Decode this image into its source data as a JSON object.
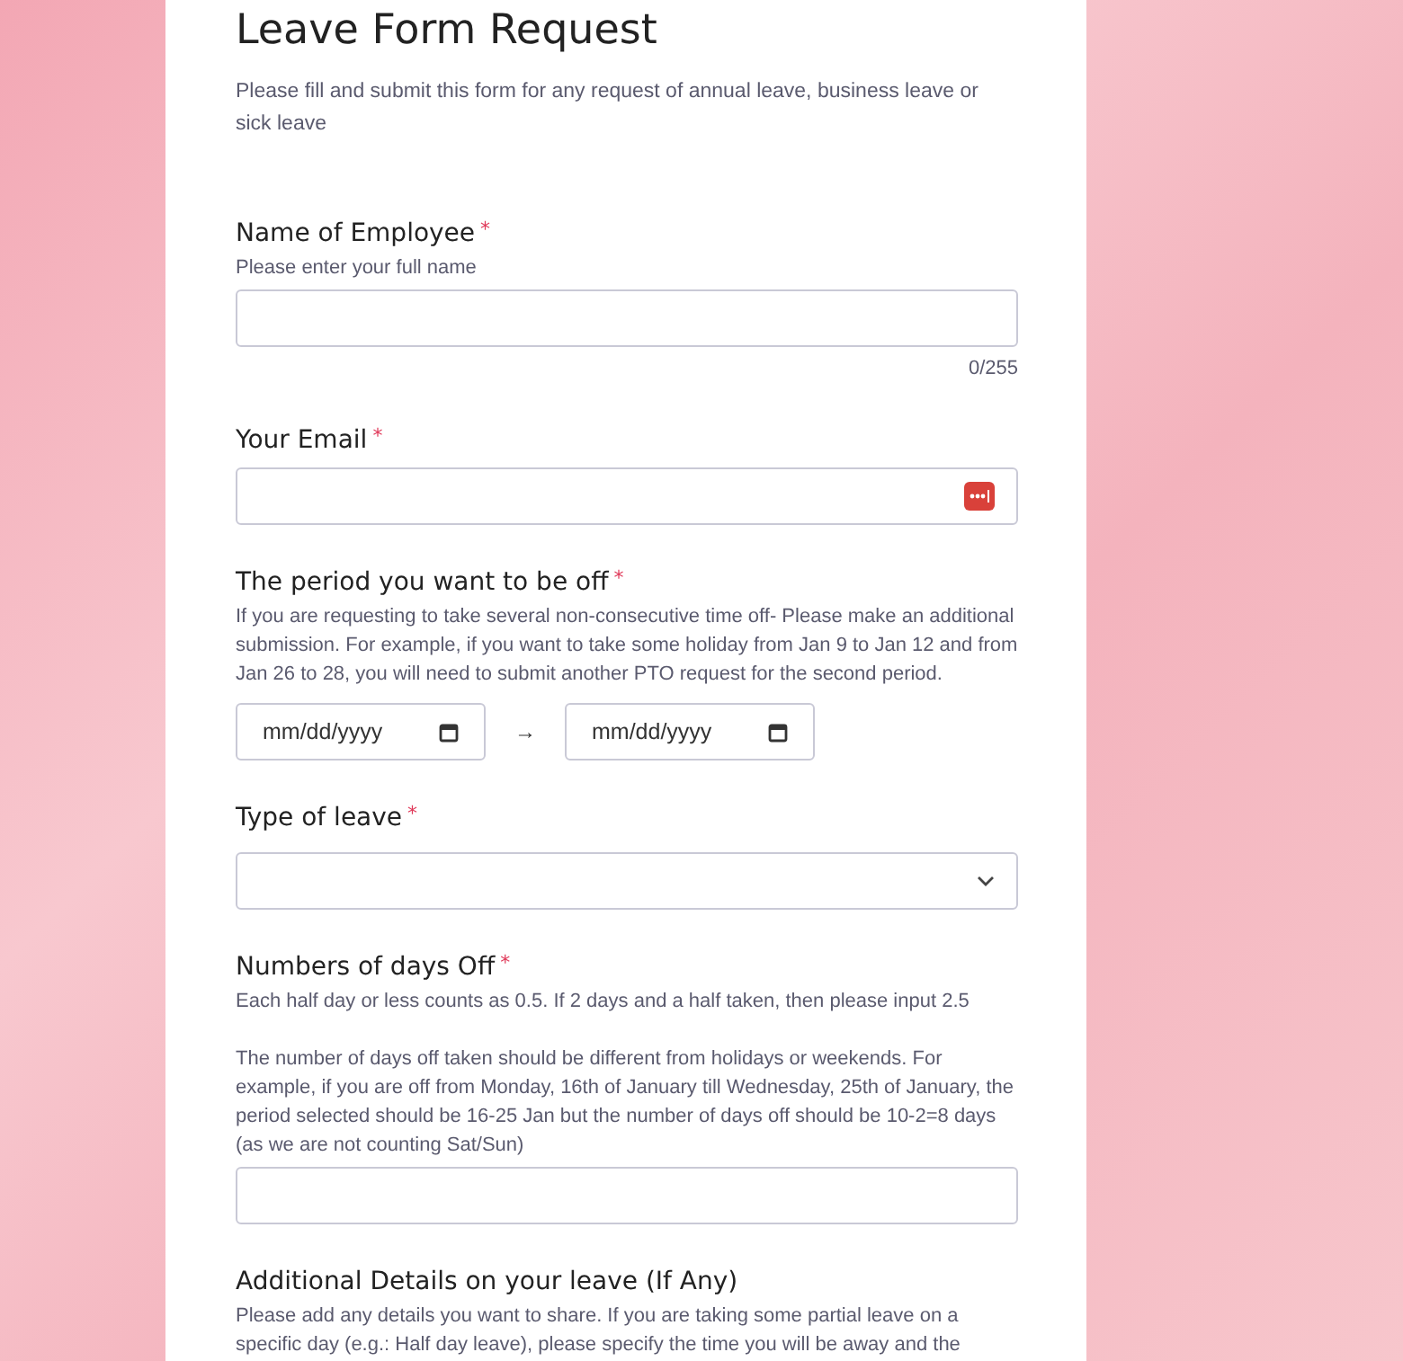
{
  "form": {
    "title": "Leave Form Request",
    "description": "Please fill and submit this form for any request of annual leave, business leave or sick leave",
    "fields": [
      {
        "kind": "text",
        "label": "Name of Employee",
        "required_mark": "*",
        "help": [
          "Please enter your full name"
        ],
        "counter": "0/255"
      },
      {
        "kind": "email",
        "label": "Your Email",
        "required_mark": "*"
      },
      {
        "kind": "date_range",
        "label": "The period you want to be off",
        "required_mark": "*",
        "help": [
          "If you are requesting to take several non-consecutive time off- Please make an additional submission. For example, if you want to take some holiday from Jan 9 to Jan 12 and from Jan 26 to 28, you will need to submit another PTO request for the second period."
        ],
        "start_placeholder": "mm/dd/yyyy",
        "separator": "→",
        "end_placeholder": "mm/dd/yyyy"
      },
      {
        "kind": "select",
        "label": "Type of leave",
        "required_mark": "*"
      },
      {
        "kind": "text",
        "label": "Numbers of days Off",
        "required_mark": "*",
        "help": [
          "Each half day or less counts as 0.5. If 2 days and a half taken, then please input 2.5",
          "The number of days off taken should be different from holidays or weekends. For example, if you are off from Monday, 16th of January till Wednesday, 25th of January, the period selected should be 16-25 Jan but the number of days off should be 10-2=8 days (as we are not counting Sat/Sun)"
        ]
      },
      {
        "kind": "heading",
        "label": "Additional Details on your leave (If Any)",
        "help": [
          "Please add any details you want to share. If you are taking some partial leave on a specific day (e.g.: Half day leave), please specify the time you will be away and the"
        ]
      }
    ]
  }
}
